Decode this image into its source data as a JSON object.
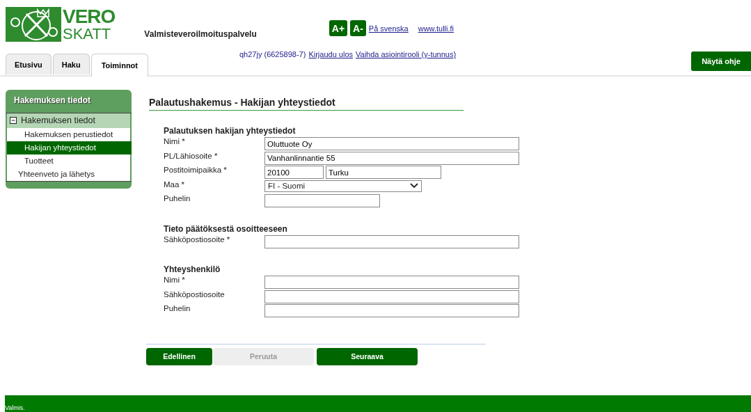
{
  "logo": {
    "lines": [
      "VERO",
      "SKATT"
    ]
  },
  "service_name": "Valmisteveroilmoituspalvelu",
  "font_buttons": [
    "A+",
    "A-"
  ],
  "top_links": [
    "På svenska",
    "www.tulli.fi"
  ],
  "tabs": [
    {
      "label": "Etusivu",
      "selected": false
    },
    {
      "label": "Haku",
      "selected": false
    },
    {
      "label": "Toiminnot",
      "selected": true
    }
  ],
  "user": {
    "id": "qh27jy (6625898-7)",
    "links": [
      "Kirjaudu ulos",
      "Vaihda asiointirooli (y-tunnus)"
    ]
  },
  "help_button": "Näytä ohje",
  "sidebar": {
    "title": "Hakemuksen tiedot",
    "items": [
      {
        "label": "Hakemuksen tiedot",
        "expanded": true,
        "selected": false,
        "children": [
          {
            "label": "Hakemuksen perustiedot",
            "selected": false
          },
          {
            "label": "Hakijan yhteystiedot",
            "selected": true
          },
          {
            "label": "Tuotteet",
            "selected": false
          }
        ]
      },
      {
        "label": "Yhteenveto ja lähetys",
        "selected": false
      }
    ]
  },
  "page_title": "Palautushakemus - Hakijan yhteystiedot",
  "sections": [
    {
      "title": "Palautuksen hakijan yhteystiedot",
      "fields": [
        {
          "label": "Nimi *",
          "kind": "text",
          "value": "Oluttuote Oy"
        },
        {
          "label": "PL/Lähiosoite *",
          "kind": "text",
          "value": "Vanhanlinnantie 55"
        },
        {
          "label": "Postitoimipaikka *",
          "kind": "postal",
          "value": "20100",
          "city": "Turku"
        },
        {
          "label": "Maa *",
          "kind": "select",
          "value": "FI - Suomi"
        },
        {
          "label": "Puhelin",
          "kind": "short_text"
        }
      ]
    },
    {
      "title": "Tieto päätöksestä osoitteeseen",
      "fields": [
        {
          "label": "Sähköpostiosoite *",
          "kind": "text"
        }
      ]
    },
    {
      "title": "Yhteyshenkilö",
      "fields": [
        {
          "label": "Nimi *",
          "kind": "text"
        },
        {
          "label": "Sähköpostiosoite",
          "kind": "text"
        },
        {
          "label": "Puhelin",
          "kind": "text"
        }
      ]
    }
  ],
  "buttons": [
    {
      "label": "Edellinen",
      "disabled": false
    },
    {
      "label": "Peruuta",
      "disabled": true
    },
    {
      "label": "Seuraava",
      "disabled": false
    }
  ],
  "status_bar": "Valmis."
}
